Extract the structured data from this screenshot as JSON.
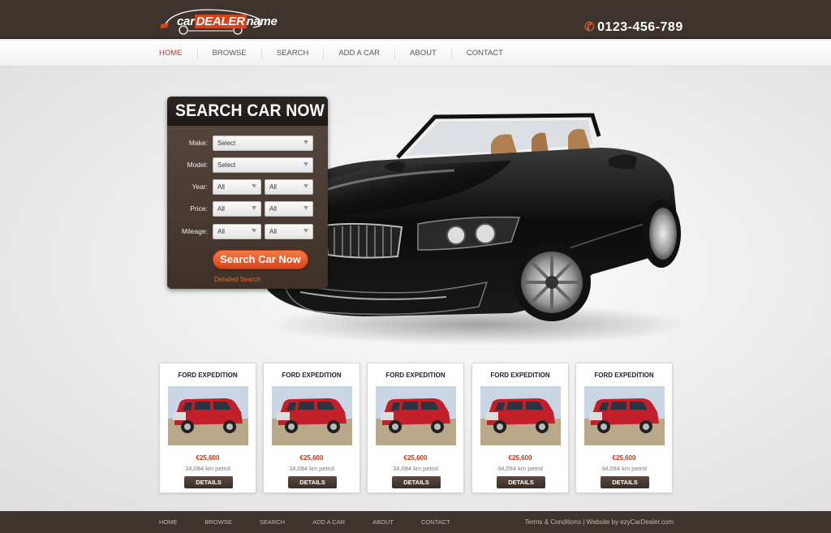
{
  "brand": {
    "logo_part1": "car",
    "logo_part2": "DEALER",
    "logo_part3": "name",
    "phone": "0123-456-789"
  },
  "nav": {
    "items": [
      "HOME",
      "BROWSE",
      "SEARCH",
      "ADD A CAR",
      "ABOUT",
      "CONTACT"
    ]
  },
  "search": {
    "title": "SEARCH CAR NOW",
    "fields": [
      {
        "label": "Make:",
        "value": "Select"
      },
      {
        "label": "Model:",
        "value": "Select"
      },
      {
        "label": "Year:",
        "from": "All",
        "to": "All"
      },
      {
        "label": "Price:",
        "from": "All",
        "to": "All"
      },
      {
        "label": "Mileage:",
        "from": "All",
        "to": "All"
      }
    ],
    "button": "Search Car Now",
    "detailed_link": "Detailed Search"
  },
  "listings": [
    {
      "title": "FORD EXPEDITION",
      "price": "€25,600",
      "details": "34,094 km petrol",
      "button": "DETAILS"
    },
    {
      "title": "FORD EXPEDITION",
      "price": "€25,600",
      "details": "34,094 km petrol",
      "button": "DETAILS"
    },
    {
      "title": "FORD EXPEDITION",
      "price": "€25,600",
      "details": "34,094 km petrol",
      "button": "DETAILS"
    },
    {
      "title": "FORD EXPEDITION",
      "price": "€25,600",
      "details": "34,094 km petrol",
      "button": "DETAILS"
    },
    {
      "title": "FORD EXPEDITION",
      "price": "€25,600",
      "details": "34,094 km petrol",
      "button": "DETAILS"
    }
  ],
  "footer": {
    "nav": [
      "HOME",
      "BROWSE",
      "SEARCH",
      "ADD A CAR",
      "ABOUT",
      "CONTACT"
    ],
    "terms": "Terms & Conditions",
    "separator": "|",
    "credit": "Website by ezyCarDealer.com"
  },
  "colors": {
    "header_bg": "#3f342d",
    "accent": "#d9431c",
    "nav_active": "#c0391b"
  }
}
